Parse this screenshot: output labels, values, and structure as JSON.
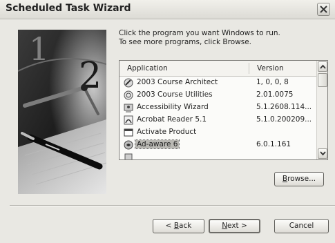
{
  "window": {
    "title": "Scheduled Task Wizard"
  },
  "instructions": {
    "line1": "Click the program you want Windows to run.",
    "line2": "To see more programs, click Browse."
  },
  "list": {
    "columns": {
      "application": "Application",
      "version": "Version"
    },
    "rows": [
      {
        "name": "2003 Course Architect",
        "version": "1, 0, 0, 8",
        "icon": "course-architect-icon"
      },
      {
        "name": "2003 Course Utilities",
        "version": "2.01.0075",
        "icon": "course-utilities-icon"
      },
      {
        "name": "Accessibility Wizard",
        "version": "5.1.2608.114...",
        "icon": "accessibility-wizard-icon"
      },
      {
        "name": "Acrobat Reader 5.1",
        "version": "5.1.0.200209...",
        "icon": "acrobat-reader-icon"
      },
      {
        "name": "Activate Product",
        "version": "",
        "icon": "window-icon"
      },
      {
        "name": "Ad-aware 6",
        "version": "6.0.1.161",
        "icon": "ad-aware-icon",
        "selected": true
      }
    ]
  },
  "buttons": {
    "browse": {
      "prefix": "",
      "hotkey": "B",
      "rest": "rowse..."
    },
    "back": {
      "prefix": "< ",
      "hotkey": "B",
      "rest": "ack"
    },
    "next": {
      "prefix": "",
      "hotkey": "N",
      "rest": "ext >"
    },
    "cancel": {
      "prefix": "",
      "hotkey": "",
      "rest": "Cancel"
    }
  }
}
